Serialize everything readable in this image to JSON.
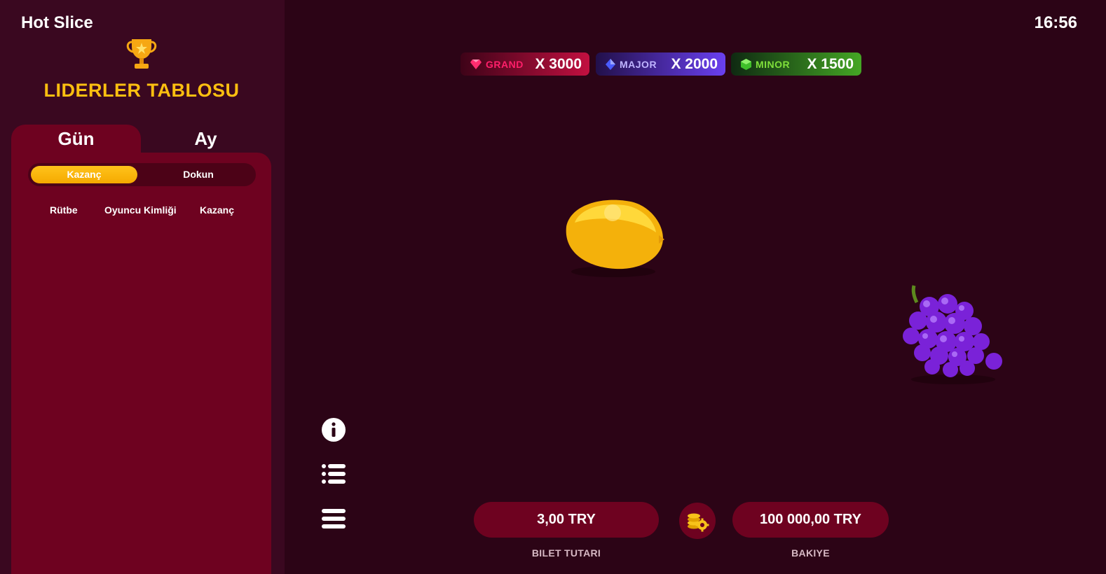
{
  "app": {
    "title": "Hot Slice",
    "clock": "16:56"
  },
  "leaderboard": {
    "title": "LIDERLER TABLOSU",
    "tabs": [
      "Gün",
      "Ay"
    ],
    "active_tab": "Gün",
    "toggle": [
      "Kazanç",
      "Dokun"
    ],
    "active_toggle": "Kazanç",
    "columns": [
      "Rütbe",
      "Oyuncu Kimliği",
      "Kazanç"
    ]
  },
  "jackpots": [
    {
      "name": "GRAND",
      "multiplier": "X 3000",
      "color": "#c11040"
    },
    {
      "name": "MAJOR",
      "multiplier": "X 2000",
      "color": "#6a40f0"
    },
    {
      "name": "MINOR",
      "multiplier": "X 1500",
      "color": "#44a624"
    }
  ],
  "controls": {
    "info_icon": "info-icon",
    "list_icon": "list-icon",
    "menu_icon": "hamburger-menu-icon"
  },
  "footer": {
    "bet_value": "3,00 TRY",
    "bet_label": "BILET TUTARI",
    "balance_value": "100 000,00 TRY",
    "balance_label": "BAKIYE",
    "coin_settings_icon": "coins-gear-icon"
  },
  "fruits": [
    "lemon",
    "grapes"
  ],
  "colors": {
    "accent": "#fcbf10",
    "panel": "#6e0220",
    "background": "#2c0416"
  }
}
